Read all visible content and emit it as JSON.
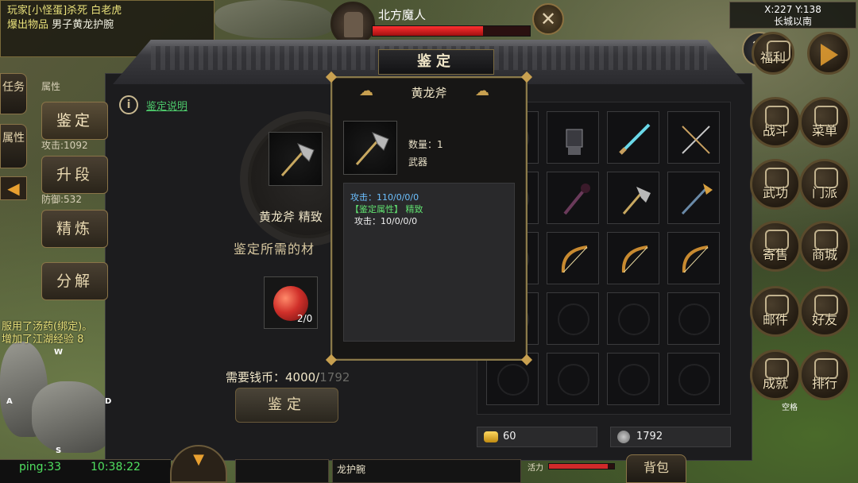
{
  "chat_log": {
    "line1_prefix": "玩家[小怪蛋]杀死 白老虎",
    "line2_label": "爆出物品",
    "line2_item": "男子黄龙护腕"
  },
  "boss": {
    "name": "北方魔人",
    "hp_fraction": 0.7,
    "close_icon": "close-icon"
  },
  "minimap": {
    "coords": "X:227 Y:138",
    "location": "长城以南"
  },
  "dialog": {
    "title": "鉴定",
    "close_icon": "close-icon",
    "info_link": "鉴定说明",
    "item_name": "黄龙斧 精致",
    "materials_label": "鉴定所需的材",
    "material_count": "2/0",
    "cost_label": "需要钱币：4000/",
    "cost_owned": "1792",
    "action_button": "鉴定"
  },
  "side_tabs": [
    {
      "label": "任务"
    },
    {
      "label": "属性"
    }
  ],
  "menu_buttons": [
    {
      "label": "鉴定"
    },
    {
      "label": "升段"
    },
    {
      "label": "精炼"
    },
    {
      "label": "分解"
    }
  ],
  "side_stats": {
    "stat1": "属性",
    "stat2": "攻击:1092",
    "stat3": "防御:532"
  },
  "tooltip": {
    "name": "黄龙斧",
    "quantity": "数量：1",
    "type": "武器",
    "attack": "攻击：110/0/0/0",
    "appraise_label": "【鉴定属性】 精致",
    "appraise_attack": "攻击：10/0/0/0"
  },
  "inventory": {
    "items": [
      {
        "name": "gauntlet-icon",
        "row": 0,
        "col": 1
      },
      {
        "name": "blue-blade-icon",
        "row": 0,
        "col": 2
      },
      {
        "name": "crossed-swords-icon",
        "row": 0,
        "col": 3
      },
      {
        "name": "dark-staff-icon",
        "row": 1,
        "col": 1
      },
      {
        "name": "axe-icon",
        "row": 1,
        "col": 2
      },
      {
        "name": "halberd-icon",
        "row": 1,
        "col": 3
      },
      {
        "name": "bow-icon",
        "row": 2,
        "col": 1
      },
      {
        "name": "bow-icon",
        "row": 2,
        "col": 2
      },
      {
        "name": "bow-icon",
        "row": 2,
        "col": 3
      }
    ],
    "gold": "60",
    "coins": "1792"
  },
  "right_buttons": [
    {
      "label": "福利",
      "icon": "gift-icon"
    },
    {
      "label": "",
      "icon": "play-arrow-icon"
    },
    {
      "label": "战斗",
      "icon": "swords-icon"
    },
    {
      "label": "菜单",
      "icon": "menu-grid-icon"
    },
    {
      "label": "武功",
      "icon": "scroll-icon"
    },
    {
      "label": "门派",
      "icon": "pavilion-icon"
    },
    {
      "label": "寄售",
      "icon": "money-bag-icon"
    },
    {
      "label": "商城",
      "icon": "gift-box-icon"
    },
    {
      "label": "邮件",
      "icon": "mail-icon"
    },
    {
      "label": "好友",
      "icon": "friend-icon"
    },
    {
      "label": "成就",
      "icon": "star-badge-icon"
    },
    {
      "label": "排行",
      "icon": "ranking-icon"
    }
  ],
  "keyboard_hint": "空格",
  "system_messages": [
    "服用了汤药(绑定)。",
    "增加了江湖经验 8"
  ],
  "compass": {
    "w": "W",
    "a": "A",
    "d": "D",
    "s": "S"
  },
  "status": {
    "ping": "ping:33",
    "time": "10:38:22"
  },
  "bottom": {
    "item_text": "龙护腕",
    "stamina_label": "活力",
    "stamina_fraction": 0.9,
    "bag_label": "背包"
  }
}
